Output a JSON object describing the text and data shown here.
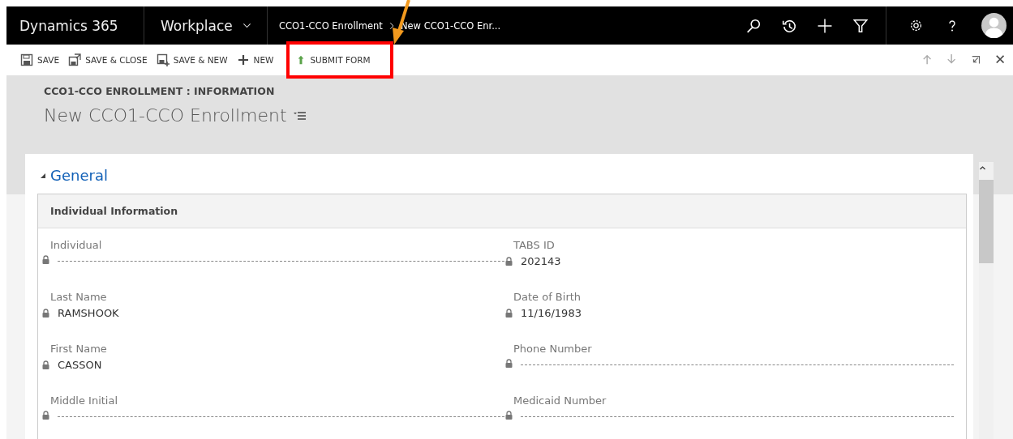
{
  "nav": {
    "app": "Dynamics 365",
    "area": "Workplace",
    "breadcrumbs": [
      "CCO1-CCO Enrollment",
      "New CCO1-CCO Enr..."
    ]
  },
  "commands": [
    {
      "label": "SAVE",
      "kind": "save",
      "highlighted": false
    },
    {
      "label": "SAVE & CLOSE",
      "kind": "saveclose",
      "highlighted": false
    },
    {
      "label": "SAVE & NEW",
      "kind": "savenew",
      "highlighted": false
    },
    {
      "label": "NEW",
      "kind": "new",
      "highlighted": false
    },
    {
      "label": "SUBMIT FORM",
      "kind": "submit",
      "highlighted": true
    }
  ],
  "header": {
    "form_label": "CCO1-CCO ENROLLMENT : INFORMATION",
    "title": "New CCO1-CCO Enrollment"
  },
  "tab": {
    "title": "General",
    "expanded": true
  },
  "section": {
    "title": "Individual Information",
    "fields": [
      {
        "label": "Individual",
        "locked": true
      },
      {
        "label": "TABS ID",
        "value": "202143",
        "locked": true
      },
      {
        "label": "Last Name",
        "value": "RAMSHOOK",
        "locked": true
      },
      {
        "label": "Date of Birth",
        "value": "11/16/1983",
        "locked": true
      },
      {
        "label": "First Name",
        "value": "CASSON",
        "locked": true
      },
      {
        "label": "Phone Number",
        "locked": true
      },
      {
        "label": "Middle Initial",
        "locked": true
      },
      {
        "label": "Medicaid Number",
        "locked": true
      }
    ]
  }
}
